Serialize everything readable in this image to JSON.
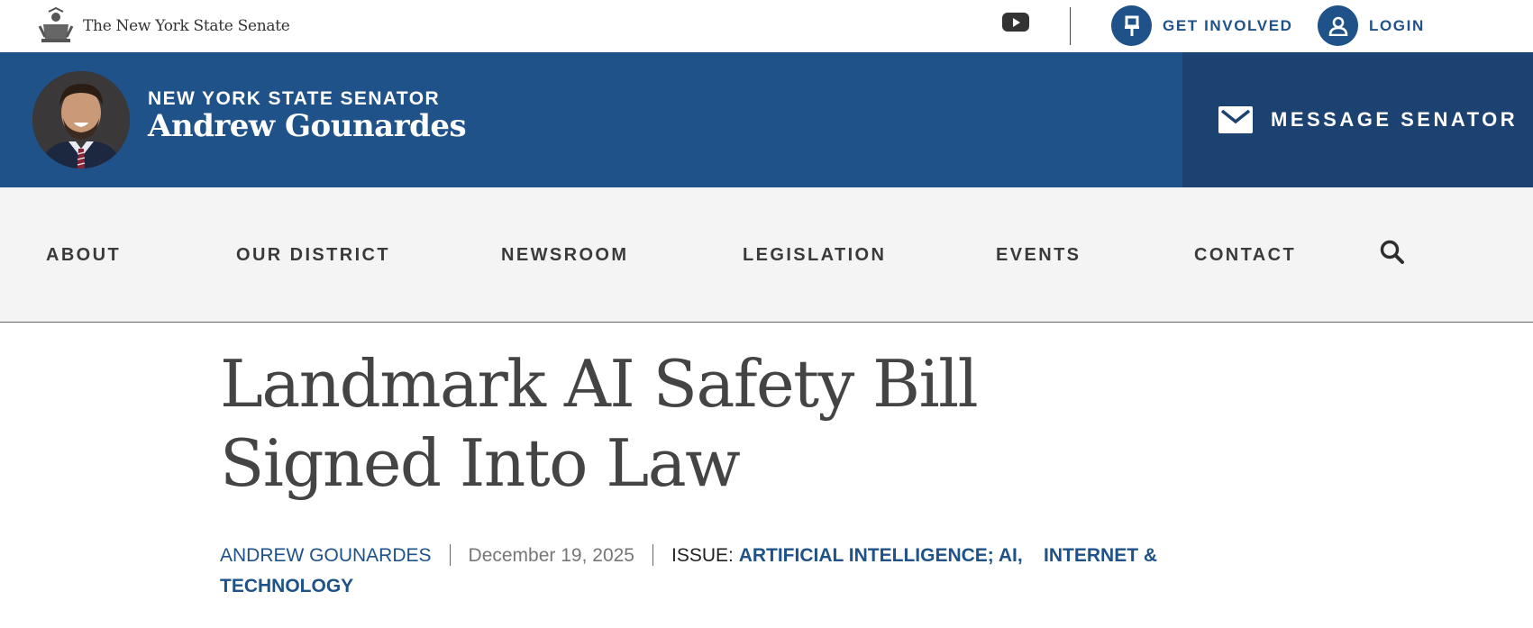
{
  "topbar": {
    "site_name": "The New York State Senate",
    "youtube_icon": "youtube-icon",
    "get_involved_label": "GET INVOLVED",
    "login_label": "LOGIN"
  },
  "banner": {
    "title": "NEW YORK STATE SENATOR",
    "name": "Andrew Gounardes",
    "message_label": "MESSAGE SENATOR"
  },
  "nav": {
    "items": [
      "ABOUT",
      "OUR DISTRICT",
      "NEWSROOM",
      "LEGISLATION",
      "EVENTS",
      "CONTACT"
    ]
  },
  "article": {
    "headline": "Landmark AI Safety Bill Signed Into Law",
    "author": "ANDREW GOUNARDES",
    "date": "December 19, 2025",
    "issue_label": "ISSUE:",
    "issues": [
      "ARTIFICIAL INTELLIGENCE; AI",
      "INTERNET & TECHNOLOGY"
    ],
    "issue_separator": ","
  },
  "colors": {
    "brand_blue": "#1e5289",
    "message_panel": "#1c4271",
    "nav_bg": "#f4f4f5"
  }
}
